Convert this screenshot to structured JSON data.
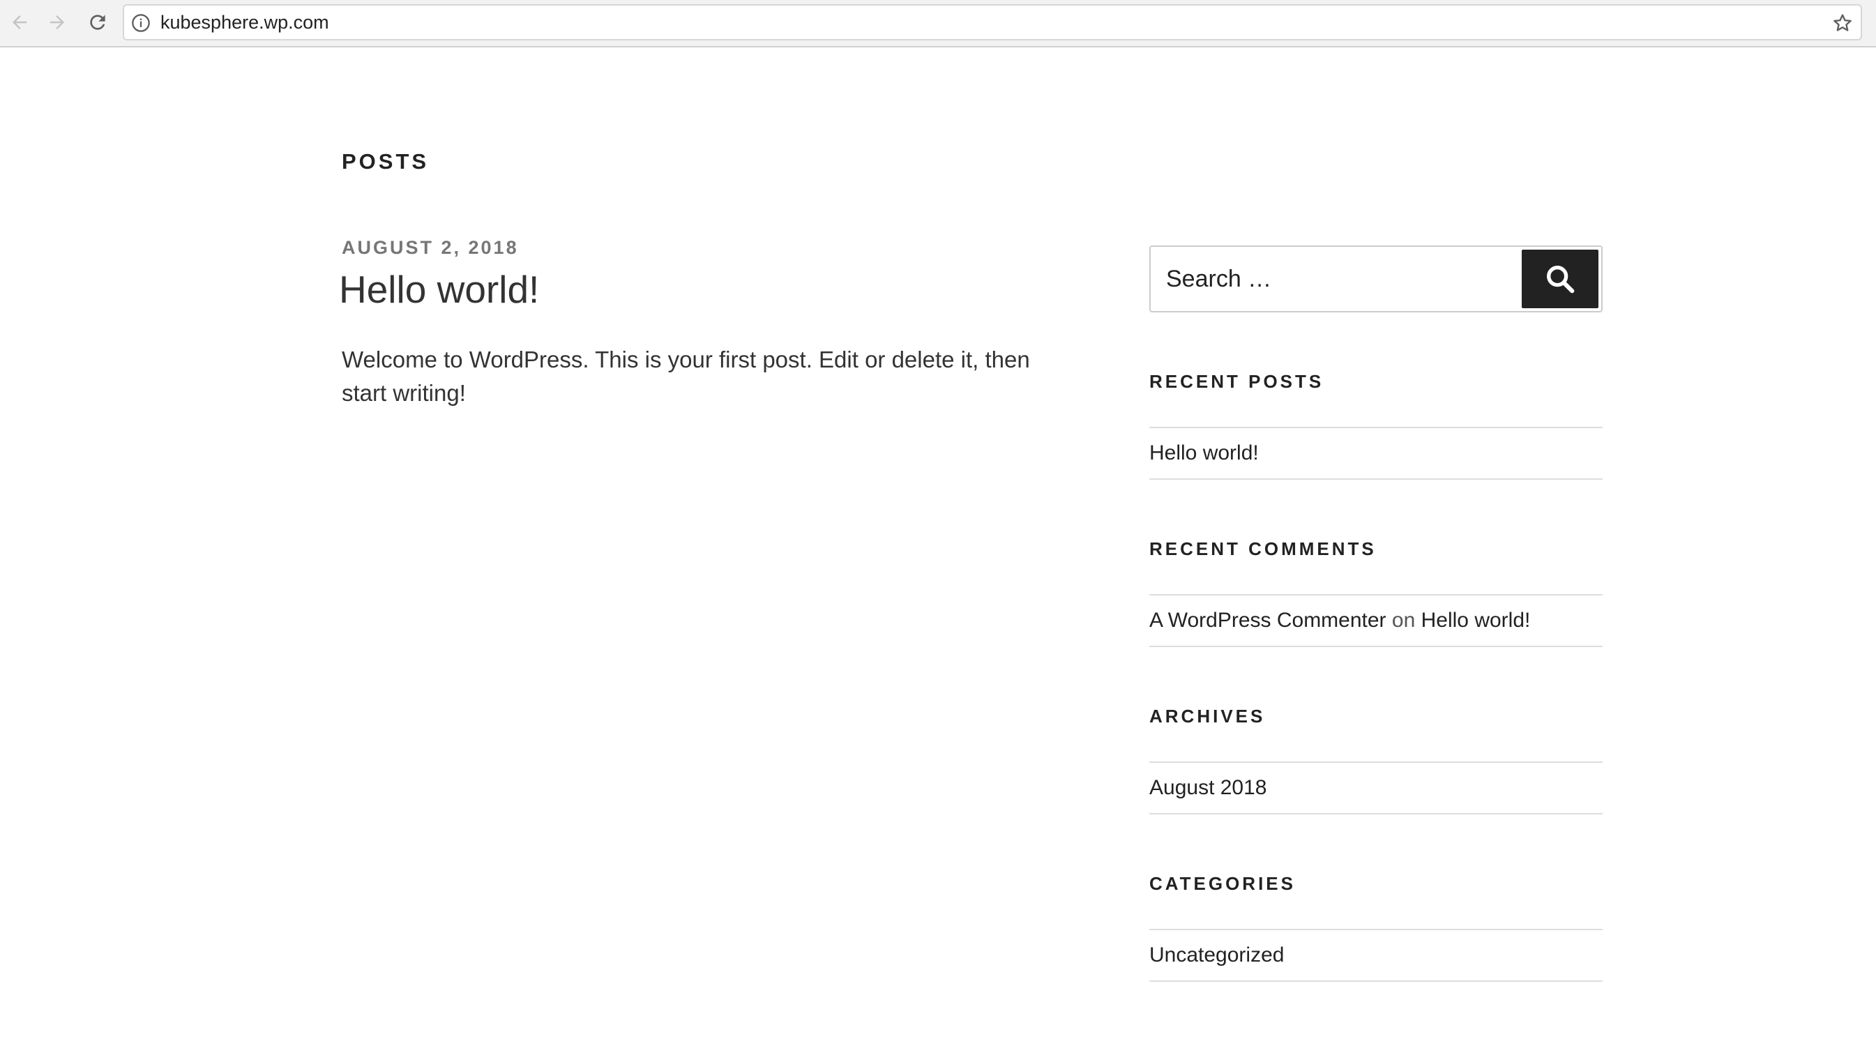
{
  "browser": {
    "url": "kubesphere.wp.com"
  },
  "page": {
    "header": "POSTS",
    "post": {
      "date": "AUGUST 2, 2018",
      "title": "Hello world!",
      "excerpt": "Welcome to WordPress. This is your first post. Edit or delete it, then start writing!"
    }
  },
  "sidebar": {
    "search": {
      "placeholder": "Search …"
    },
    "recent_posts": {
      "title": "RECENT POSTS",
      "items": [
        "Hello world!"
      ]
    },
    "recent_comments": {
      "title": "RECENT COMMENTS",
      "author": "A WordPress Commenter",
      "connector": "on",
      "post": "Hello world!"
    },
    "archives": {
      "title": "ARCHIVES",
      "items": [
        "August 2018"
      ]
    },
    "categories": {
      "title": "CATEGORIES",
      "items": [
        "Uncategorized"
      ]
    }
  },
  "icons": {
    "back": "arrow-left-icon",
    "forward": "arrow-right-icon",
    "reload": "reload-icon",
    "info": "info-icon",
    "bookmark": "star-icon",
    "search": "search-icon"
  },
  "colors": {
    "accent_dark": "#222222",
    "date_gray": "#767676",
    "divider": "#dddddd"
  }
}
